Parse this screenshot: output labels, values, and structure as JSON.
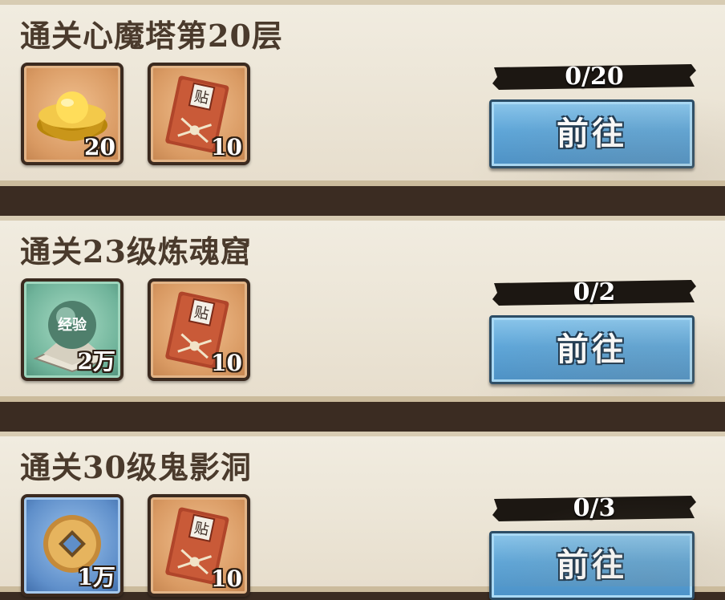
{
  "tasks": [
    {
      "title": "通关心魔塔第20层",
      "rewards": [
        {
          "icon": "gold-ingot-icon",
          "count": "20",
          "frame": "orange"
        },
        {
          "icon": "red-book-icon",
          "count": "10",
          "frame": "orange"
        }
      ],
      "progress": "0/20",
      "button": "前往"
    },
    {
      "title": "通关23级炼魂窟",
      "rewards": [
        {
          "icon": "experience-orb-icon",
          "count": "2万",
          "frame": "green",
          "label": "经验"
        },
        {
          "icon": "red-book-icon",
          "count": "10",
          "frame": "orange"
        }
      ],
      "progress": "0/2",
      "button": "前往"
    },
    {
      "title": "通关30级鬼影洞",
      "rewards": [
        {
          "icon": "copper-coin-icon",
          "count": "1万",
          "frame": "blue"
        },
        {
          "icon": "red-book-icon",
          "count": "10",
          "frame": "orange"
        }
      ],
      "progress": "0/3",
      "button": "前往"
    }
  ],
  "book_label": "贴"
}
